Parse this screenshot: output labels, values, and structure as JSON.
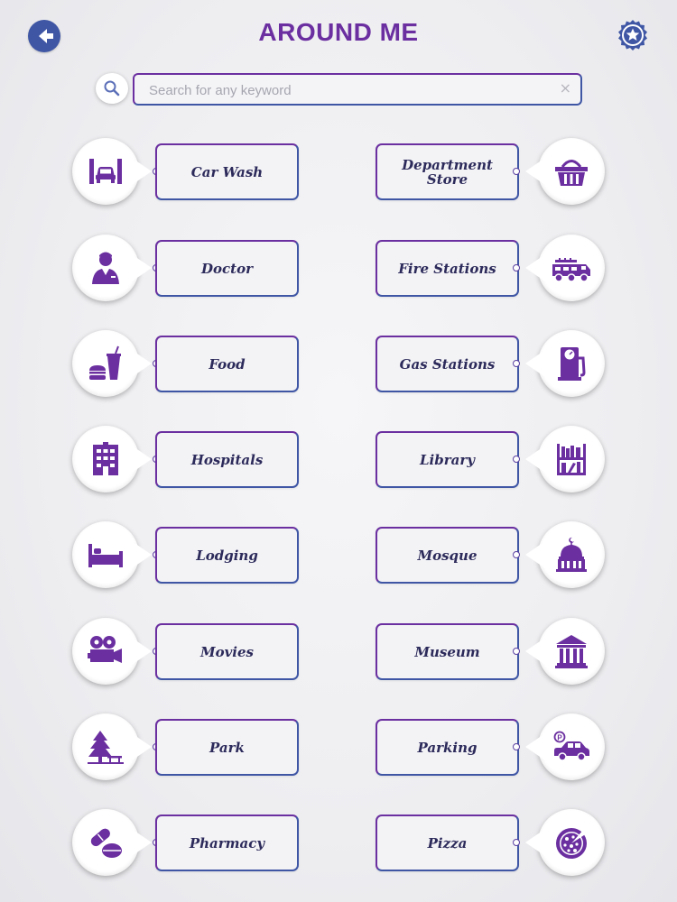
{
  "header": {
    "title": "AROUND ME"
  },
  "search": {
    "placeholder": "Search for any keyword",
    "clear_label": "×"
  },
  "colors": {
    "purple": "#6b2fa0",
    "blue": "#3f56a5",
    "icon": "#6b2fa0"
  },
  "categories": {
    "left": [
      {
        "label": "Car Wash",
        "icon": "car-wash-icon"
      },
      {
        "label": "Doctor",
        "icon": "doctor-icon"
      },
      {
        "label": "Food",
        "icon": "food-icon"
      },
      {
        "label": "Hospitals",
        "icon": "hospital-icon"
      },
      {
        "label": "Lodging",
        "icon": "bed-icon"
      },
      {
        "label": "Movies",
        "icon": "movie-camera-icon"
      },
      {
        "label": "Park",
        "icon": "tree-bench-icon"
      },
      {
        "label": "Pharmacy",
        "icon": "pills-icon"
      }
    ],
    "right": [
      {
        "label": "Department Store",
        "icon": "basket-icon"
      },
      {
        "label": "Fire Stations",
        "icon": "fire-truck-icon"
      },
      {
        "label": "Gas Stations",
        "icon": "gas-pump-icon"
      },
      {
        "label": "Library",
        "icon": "bookshelf-icon"
      },
      {
        "label": "Mosque",
        "icon": "mosque-icon"
      },
      {
        "label": "Museum",
        "icon": "museum-icon"
      },
      {
        "label": "Parking",
        "icon": "parking-car-icon"
      },
      {
        "label": "Pizza",
        "icon": "pizza-icon"
      }
    ]
  }
}
